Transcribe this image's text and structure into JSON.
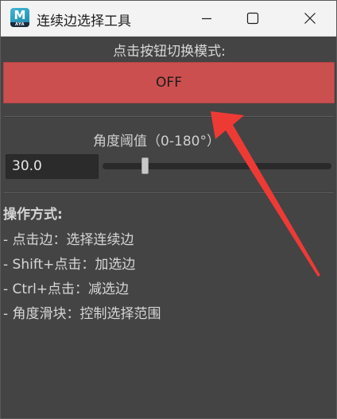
{
  "window": {
    "title": "连续边选择工具",
    "app_icon_letter": "M",
    "app_icon_strip": "AYA"
  },
  "mode": {
    "label": "点击按钮切换模式:",
    "button_text": "OFF",
    "button_color": "#cc4f4f"
  },
  "angle": {
    "label": "角度阈值（0-180°）",
    "value": "30.0",
    "slider": {
      "min": 0,
      "max": 180,
      "value": 30
    }
  },
  "instructions": {
    "title": "操作方式:",
    "lines": [
      "- 点击边：选择连续边",
      "- Shift+点击：加选边",
      "- Ctrl+点击：减选边",
      "- 角度滑块：控制选择范围"
    ]
  },
  "icons": {
    "minimize": "minimize-icon",
    "maximize": "maximize-icon",
    "close": "close-icon",
    "annotation": "red-arrow-annotation"
  },
  "colors": {
    "panel_bg": "#444444",
    "titlebar_bg": "#f3f3f3",
    "arrow": "#ee3a35"
  }
}
